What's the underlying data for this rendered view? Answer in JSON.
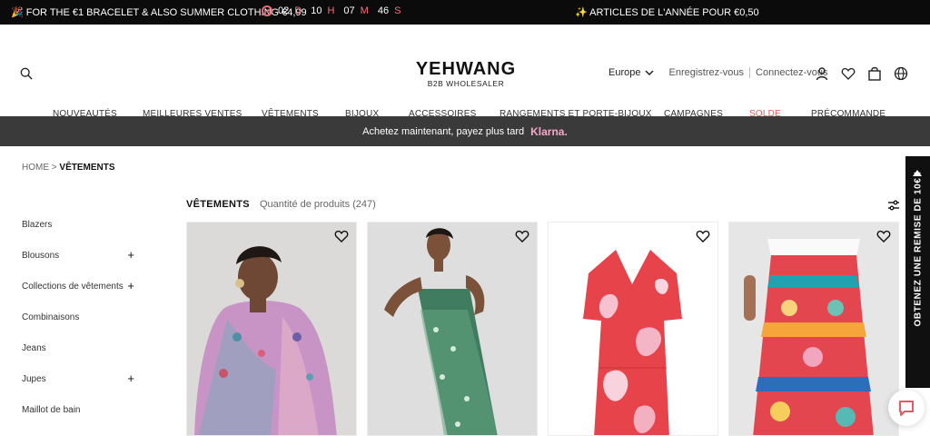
{
  "topbar": {
    "promo_text": "🎉 FOR THE €1 BRACELET & ALSO SUMMER CLOTHING €4,99",
    "countdown": {
      "days_value": "02",
      "days_unit": "D",
      "hours_value": "10",
      "hours_unit": "H",
      "minutes_value": "07",
      "minutes_unit": "M",
      "seconds_value": "46",
      "seconds_unit": "S"
    },
    "right_promo": "✨ ARTICLES DE L'ANNÉE POUR €0,50"
  },
  "header": {
    "brand": "YEHWANG",
    "subtitle": "B2B WHOLESALER",
    "region": "Europe",
    "register": "Enregistrez-vous",
    "login": "Connectez-vous"
  },
  "nav": [
    {
      "label": "NOUVEAUTÉS"
    },
    {
      "label": "MEILLEURES VENTES"
    },
    {
      "label": "VÊTEMENTS"
    },
    {
      "label": "BIJOUX"
    },
    {
      "label": "ACCESSOIRES"
    },
    {
      "label": "RANGEMENTS ET PORTE-BIJOUX"
    },
    {
      "label": "CAMPAGNES"
    },
    {
      "label": "SOLDE"
    },
    {
      "label": "PRÉCOMMANDE"
    }
  ],
  "klarna": {
    "text": "Achetez maintenant, payez plus tard",
    "brand": "Klarna."
  },
  "breadcrumb": {
    "home": "HOME",
    "separator": ">",
    "current": "VÊTEMENTS"
  },
  "sidebar": [
    {
      "label": "Blazers",
      "has_plus": false
    },
    {
      "label": "Blousons",
      "has_plus": true
    },
    {
      "label": "Collections de vêtements",
      "has_plus": true
    },
    {
      "label": "Combinaisons",
      "has_plus": false
    },
    {
      "label": "Jeans",
      "has_plus": false
    },
    {
      "label": "Jupes",
      "has_plus": true
    },
    {
      "label": "Maillot de bain",
      "has_plus": false
    }
  ],
  "sidebar_plus": "+",
  "results": {
    "title": "VÊTEMENTS",
    "count": "Quantité de produits (247)"
  },
  "side_tab": {
    "text": "OBTENEZ UNE REMISE DE 10€ !"
  },
  "colors": {
    "accent": "#e35a5a",
    "countdown_unit": "#ff6b80",
    "klarna_pink": "#f7a7c9",
    "dark": "#0b0b0b"
  },
  "icons": [
    "search-icon",
    "chevron-down-icon",
    "user-icon",
    "heart-icon",
    "bag-icon",
    "globe-icon",
    "filter-icon",
    "chat-icon"
  ]
}
